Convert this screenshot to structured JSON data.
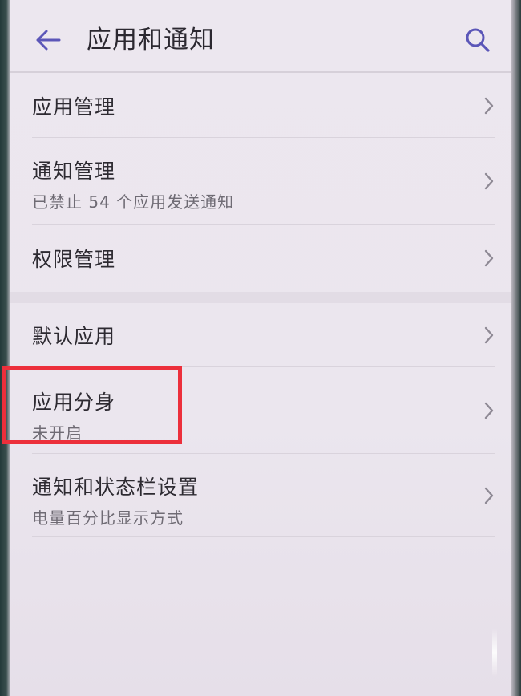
{
  "header": {
    "title": "应用和通知",
    "back_icon": "arrow-left-icon",
    "search_icon": "search-icon",
    "accent_color": "#5b56b8"
  },
  "items": [
    {
      "title": "应用管理",
      "subtitle": ""
    },
    {
      "title": "通知管理",
      "subtitle": "已禁止 54 个应用发送通知"
    },
    {
      "title": "权限管理",
      "subtitle": ""
    },
    {
      "title": "默认应用",
      "subtitle": ""
    },
    {
      "title": "应用分身",
      "subtitle": "未开启"
    },
    {
      "title": "通知和状态栏设置",
      "subtitle": "电量百分比显示方式"
    }
  ],
  "highlight": {
    "color": "#ec2f3b",
    "target": "应用分身"
  },
  "chevron_icon": "chevron-right-icon"
}
